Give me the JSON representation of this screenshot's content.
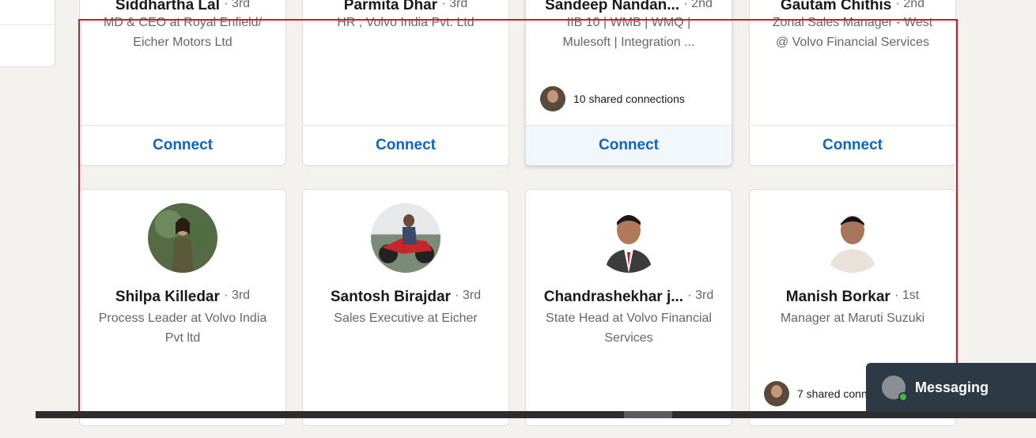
{
  "top_row": [
    {
      "name": "Siddhartha Lal",
      "degree": "· 3rd",
      "headline_lines": [
        "MD & CEO at Royal Enfield/",
        "Eicher Motors Ltd"
      ],
      "button": "Connect"
    },
    {
      "name": "Parmita Dhar",
      "degree": "· 3rd",
      "headline_lines": [
        "HR , Volvo India Pvt. Ltd",
        ""
      ],
      "button": "Connect"
    },
    {
      "name": "Sandeep Nandan...",
      "degree": "· 2nd",
      "headline_lines": [
        "IIB 10 | WMB | WMQ |",
        "Mulesoft | Integration ..."
      ],
      "shared": "10 shared connections",
      "button": "Connect"
    },
    {
      "name": "Gautam Chithis",
      "degree": "· 2nd",
      "headline_lines": [
        "Zonal Sales Manager - West",
        "@ Volvo Financial Services"
      ],
      "button": "Connect"
    }
  ],
  "bottom_row": [
    {
      "name": "Shilpa Killedar",
      "degree": "· 3rd",
      "headline_lines": [
        "Process Leader at Volvo India",
        "Pvt ltd"
      ]
    },
    {
      "name": "Santosh Birajdar",
      "degree": "· 3rd",
      "headline_lines": [
        "Sales Executive at Eicher",
        ""
      ]
    },
    {
      "name": "Chandrashekhar j...",
      "degree": "· 3rd",
      "headline_lines": [
        "State Head at Volvo Financial",
        "Services"
      ]
    },
    {
      "name": "Manish Borkar",
      "degree": "· 1st",
      "headline_lines": [
        "Manager at Maruti Suzuki",
        ""
      ],
      "shared": "7 shared connections"
    }
  ],
  "messaging": {
    "label": "Messaging"
  },
  "colors": {
    "accent": "#0a66c2",
    "highlight": "#e0161c",
    "messaging_bg": "#2b3a44"
  }
}
